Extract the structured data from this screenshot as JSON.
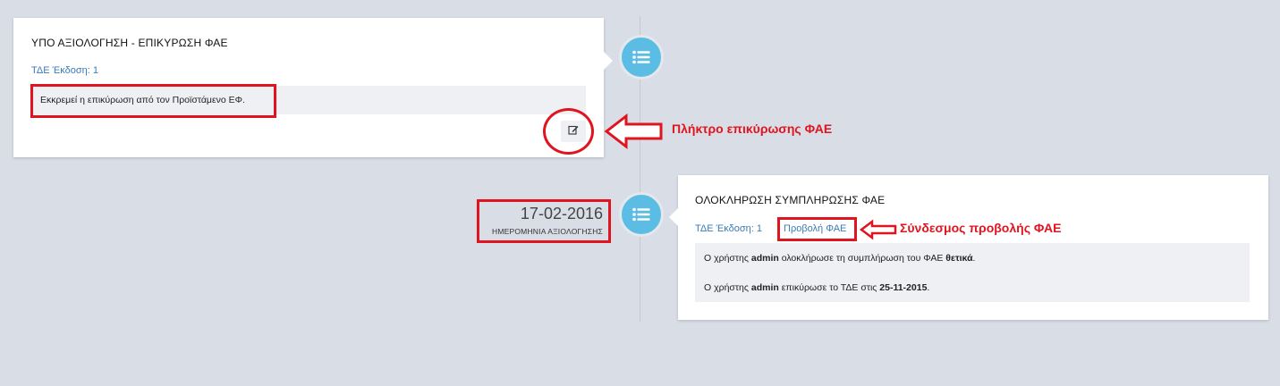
{
  "timeline": {
    "entries": [
      {
        "title": "ΥΠΟ ΑΞΙΟΛΟΓΗΣΗ - ΕΠΙΚΥΡΩΣΗ ΦΑΕ",
        "version_link": "ΤΔΕ Έκδοση: 1",
        "message": "Εκκρεμεί η επικύρωση από τον Προϊστάμενο ΕΦ.",
        "icon": "list-icon",
        "action_icon": "edit-icon"
      },
      {
        "title": "ΟΛΟΚΛΗΡΩΣΗ ΣΥΜΠΛΗΡΩΣΗΣ ΦΑΕ",
        "version_link": "ΤΔΕ Έκδοση: 1",
        "view_link": "Προβολή ΦΑΕ",
        "date": "17-02-2016",
        "date_label": "ΗΜΕΡΟΜΗΝΙΑ ΑΞΙΟΛΟΓΗΣΗΣ",
        "icon": "list-icon",
        "messages": [
          {
            "prefix": "Ο χρήστης",
            "user": "admin",
            "middle": "ολοκλήρωσε τη συμπλήρωση του ΦΑΕ",
            "emphasis": "θετικά",
            "suffix": "."
          },
          {
            "prefix": "Ο χρήστης",
            "user": "admin",
            "middle": "επικύρωσε το ΤΔΕ στις",
            "emphasis": "25-11-2015",
            "suffix": "."
          }
        ]
      }
    ]
  },
  "annotations": {
    "validate_button": "Πλήκτρο επικύρωσης ΦΑΕ",
    "view_link": "Σύνδεσμος προβολής ΦΑΕ"
  },
  "colors": {
    "background": "#d8dde6",
    "accent": "#5bbde4",
    "link": "#3a7bb8",
    "annotation": "#e0141e"
  }
}
